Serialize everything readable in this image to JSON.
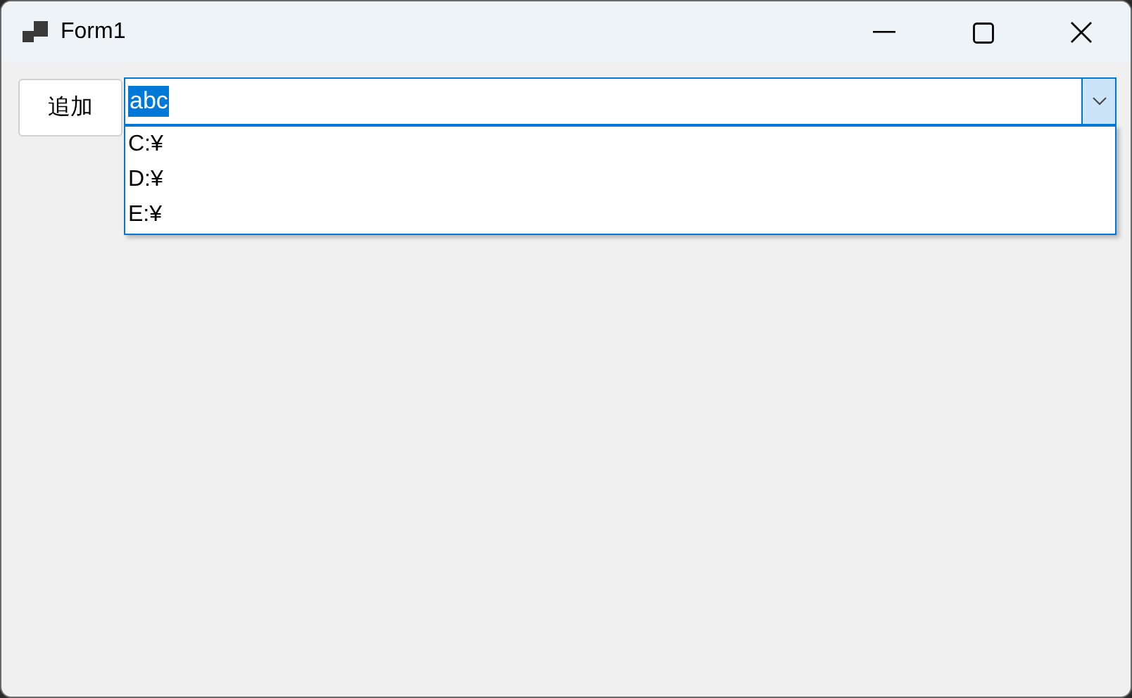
{
  "window": {
    "title": "Form1"
  },
  "add_button": {
    "label": "追加"
  },
  "combo_box": {
    "value": "abc",
    "text_selected": true,
    "expanded": true,
    "options": [
      {
        "label": "C:¥",
        "selected": false
      },
      {
        "label": "D:¥",
        "selected": false
      },
      {
        "label": "E:¥",
        "selected": false
      }
    ]
  }
}
